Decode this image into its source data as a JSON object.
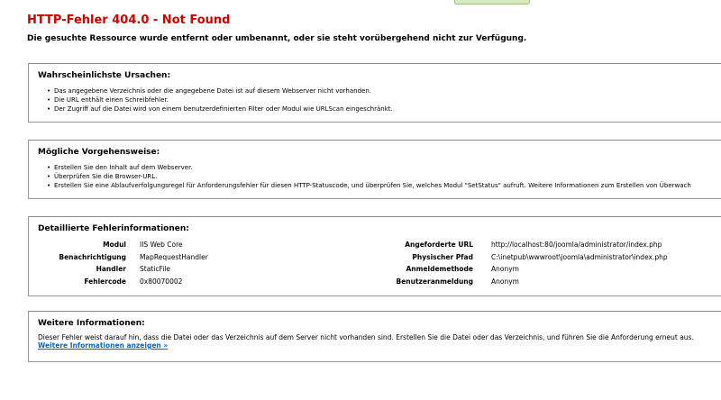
{
  "page": {
    "title": "HTTP-Fehler 404.0 - Not Found",
    "subtitle": "Die gesuchte Ressource wurde entfernt oder umbenannt, oder sie steht vorübergehend nicht zur Verfügung."
  },
  "causes": {
    "heading": "Wahrscheinlichste Ursachen:",
    "items": [
      "Das angegebene Verzeichnis oder die angegebene Datei ist auf diesem Webserver nicht vorhanden.",
      "Die URL enthält einen Schreibfehler.",
      "Der Zugriff auf die Datei wird von einem benutzerdefinierten Filter oder Modul wie URLScan eingeschränkt."
    ]
  },
  "actions": {
    "heading": "Mögliche Vorgehensweise:",
    "items": [
      "Erstellen Sie den Inhalt auf dem Webserver.",
      "Überprüfen Sie die Browser-URL.",
      "Erstellen Sie eine Ablaufverfolgungsregel für Anforderungsfehler für diesen HTTP-Statuscode, und überprüfen Sie, welches Modul \"SetStatus\" aufruft. Weitere Informationen zum Erstellen von Überwach"
    ]
  },
  "details": {
    "heading": "Detaillierte Fehlerinformationen:",
    "left": [
      {
        "label": "Modul",
        "value": "IIS Web Core"
      },
      {
        "label": "Benachrichtigung",
        "value": "MapRequestHandler"
      },
      {
        "label": "Handler",
        "value": "StaticFile"
      },
      {
        "label": "Fehlercode",
        "value": "0x80070002"
      }
    ],
    "right": [
      {
        "label": "Angeforderte URL",
        "value": "http://localhost:80/joomla/administrator/index.php"
      },
      {
        "label": "Physischer Pfad",
        "value": "C:\\inetpub\\wwwroot\\joomla\\administrator\\index.php"
      },
      {
        "label": "Anmeldemethode",
        "value": "Anonym"
      },
      {
        "label": "Benutzeranmeldung",
        "value": "Anonym"
      }
    ]
  },
  "more": {
    "heading": "Weitere Informationen:",
    "text": "Dieser Fehler weist darauf hin, dass die Datei oder das Verzeichnis auf dem Server nicht vorhanden sind. Erstellen Sie die Datei oder das Verzeichnis, und führen Sie die Anforderung erneut aus.",
    "link": "Weitere Informationen anzeigen »"
  }
}
